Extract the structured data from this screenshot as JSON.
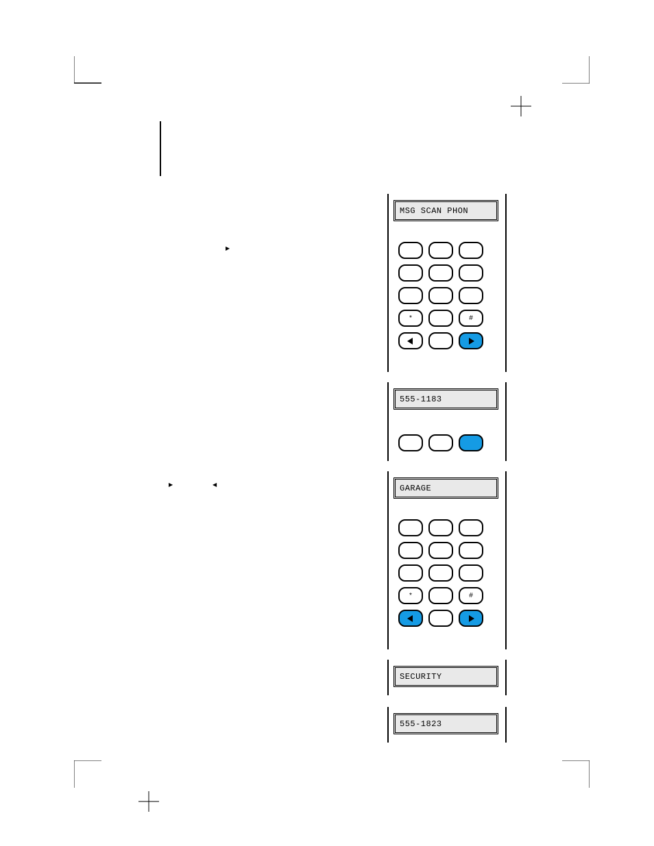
{
  "lcd": {
    "menu": "MSG  SCAN PHON",
    "number1": "555-1183",
    "garage": "GARAGE",
    "security": "SECURITY",
    "number2": "555-1823"
  },
  "keys": {
    "star": "*",
    "hash": "#",
    "blank": ""
  },
  "glyphs": {
    "arrow_right": "▶",
    "arrow_left": "◀"
  },
  "colors": {
    "accent": "#159be4",
    "lcd_bg": "#e9e9e9"
  }
}
